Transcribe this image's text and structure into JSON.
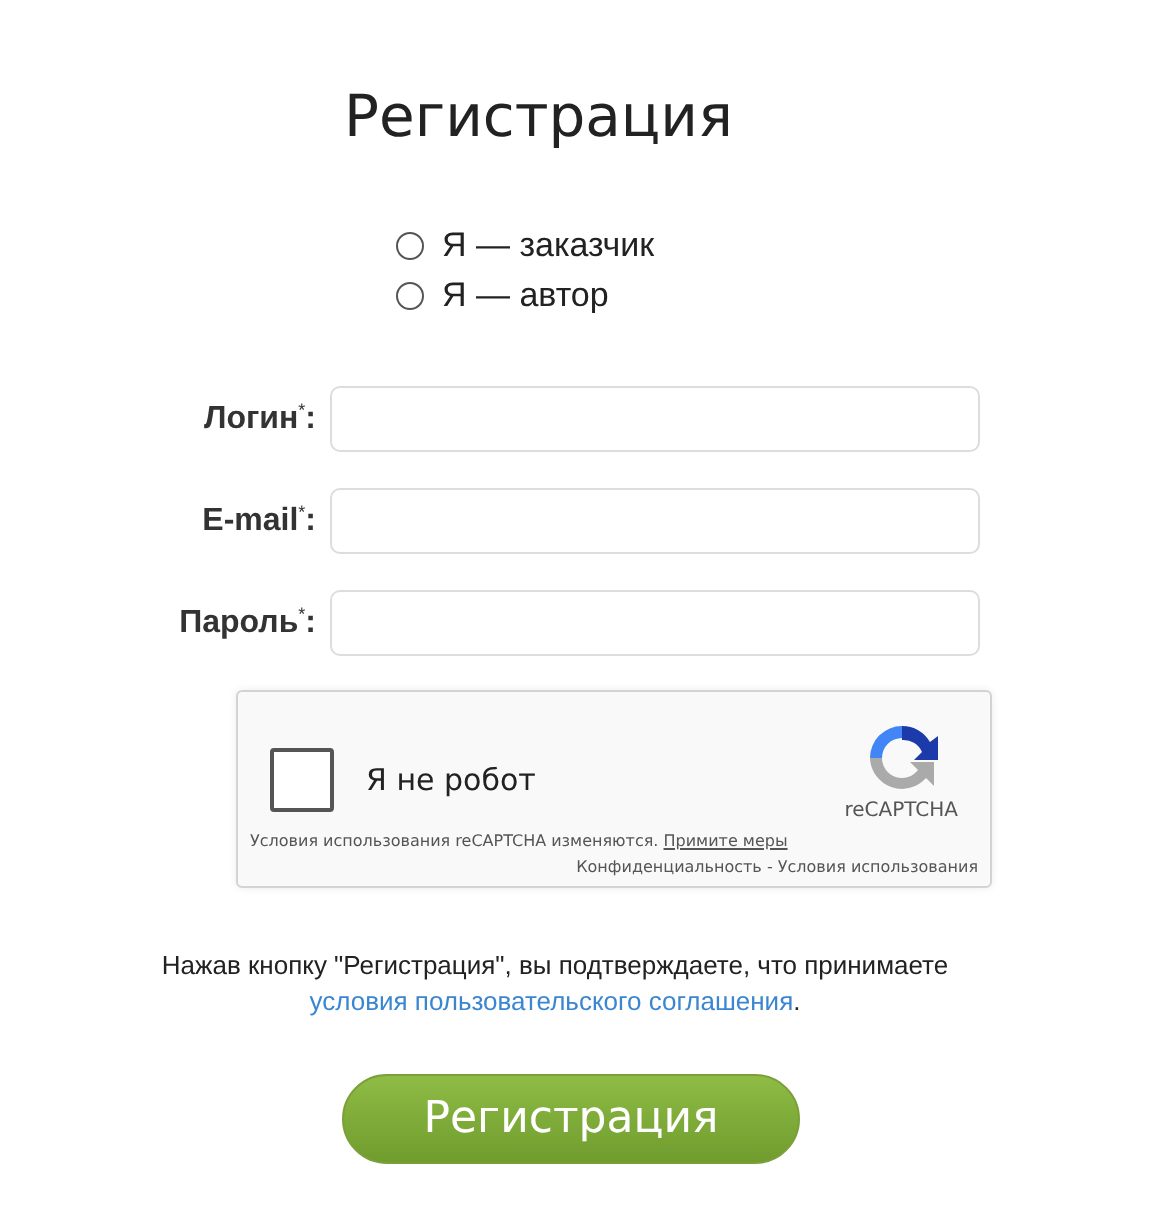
{
  "title": "Регистрация",
  "roles": [
    {
      "label": "Я — заказчик",
      "selected": false
    },
    {
      "label": "Я — автор",
      "selected": false
    }
  ],
  "fields": [
    {
      "label": "Логин$^{*}$:"
    },
    {
      "label": "E-mail$^{*}$:"
    },
    {
      "label": "Пароль$^{*}$:"
    }
  ],
  "captcha": {
    "checked": false,
    "label": "Я не робот",
    "brand": "reCAPTCHA",
    "notice": "Условия использования reCAPTCHA изменяются.",
    "notice_link": "Примите меры",
    "privacy": "Конфиденциальность",
    "separator": "-",
    "terms": "Условия использования"
  },
  "consent": {
    "text": "Нажав кнопку \"Регистрация\", вы подтверждаете, что принимаете",
    "link": "условия пользовательского соглашения",
    "end": "."
  },
  "submit": "Регистрация"
}
